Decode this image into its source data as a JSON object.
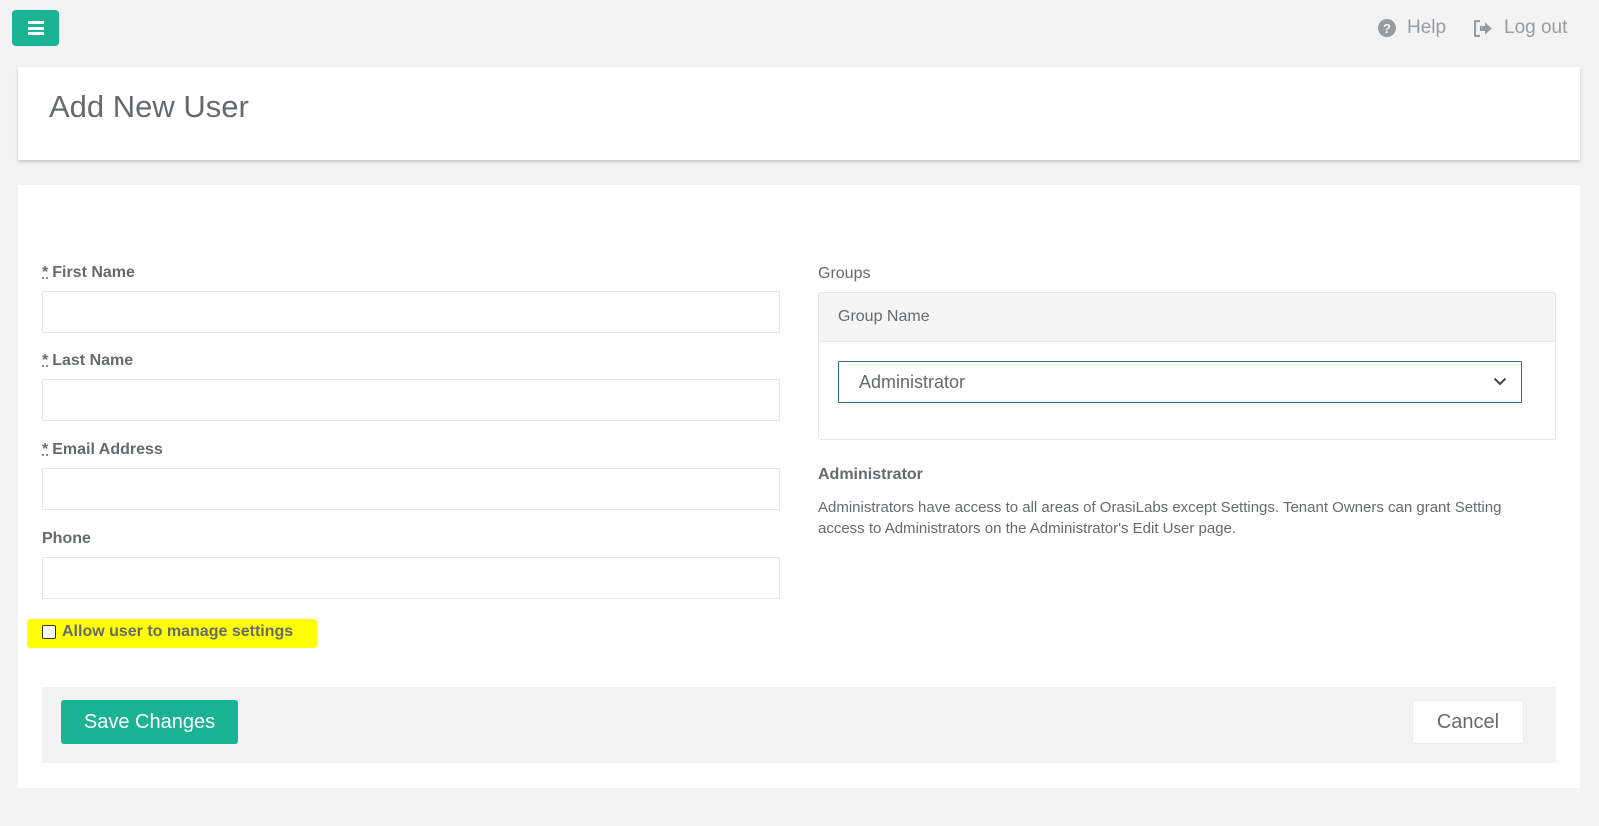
{
  "topbar": {
    "menu_icon": "hamburger-icon",
    "help_label": "Help",
    "help_icon": "question-circle-icon",
    "logout_label": "Log out",
    "logout_icon": "sign-out-icon"
  },
  "page": {
    "title": "Add New User"
  },
  "form": {
    "required_marker": "*",
    "first_name": {
      "label": "First Name",
      "value": ""
    },
    "last_name": {
      "label": "Last Name",
      "value": ""
    },
    "email": {
      "label": "Email Address",
      "value": ""
    },
    "phone": {
      "label": "Phone",
      "value": ""
    },
    "manage_settings": {
      "label": "Allow user to manage settings",
      "checked": false
    }
  },
  "groups": {
    "label": "Groups",
    "column_header": "Group Name",
    "selected": "Administrator",
    "description_title": "Administrator",
    "description": "Administrators have access to all areas of OrasiLabs except Settings. Tenant Owners can grant Setting access to Administrators on the Administrator's Edit User page."
  },
  "actions": {
    "save_label": "Save Changes",
    "cancel_label": "Cancel"
  },
  "colors": {
    "accent": "#1ab394",
    "highlight": "#ffff00",
    "text": "#676a6c",
    "background": "#f3f3f4"
  }
}
